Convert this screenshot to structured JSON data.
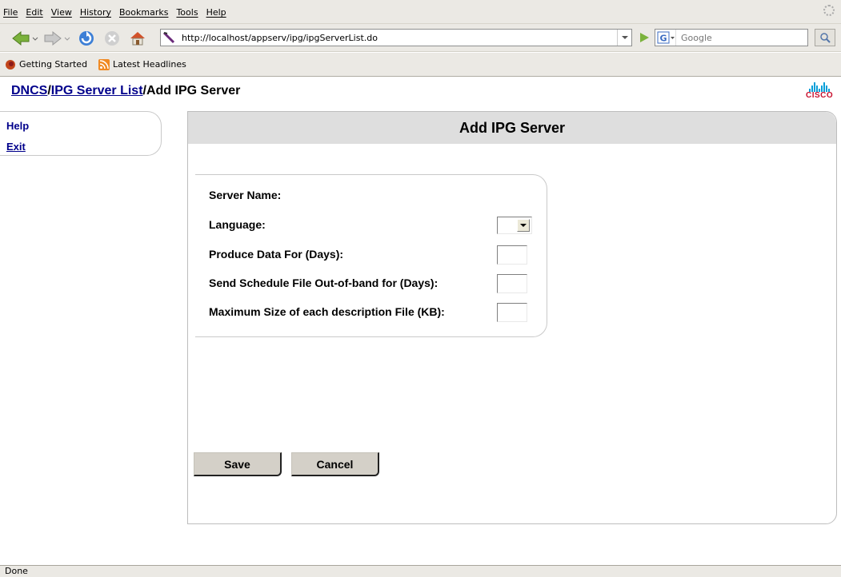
{
  "browser": {
    "menu": [
      "File",
      "Edit",
      "View",
      "History",
      "Bookmarks",
      "Tools",
      "Help"
    ],
    "url": "http://localhost/appserv/ipg/ipgServerList.do",
    "search_placeholder": "Google",
    "bookmarks": [
      "Getting Started",
      "Latest Headlines"
    ],
    "status": "Done"
  },
  "breadcrumb": {
    "root": "DNCS",
    "sep1": "/",
    "list": "IPG Server List",
    "sep2": "/",
    "current": "Add IPG Server"
  },
  "logo_text": "CISCO",
  "leftnav": {
    "help": "Help",
    "exit": "Exit"
  },
  "panel": {
    "title": "Add IPG Server"
  },
  "form": {
    "server_name": "Server Name:",
    "language": "Language:",
    "produce_data": "Produce Data For (Days):",
    "send_schedule": "Send Schedule File Out-of-band for (Days):",
    "max_size": "Maximum Size of each description File (KB):"
  },
  "buttons": {
    "save": "Save",
    "cancel": "Cancel"
  }
}
